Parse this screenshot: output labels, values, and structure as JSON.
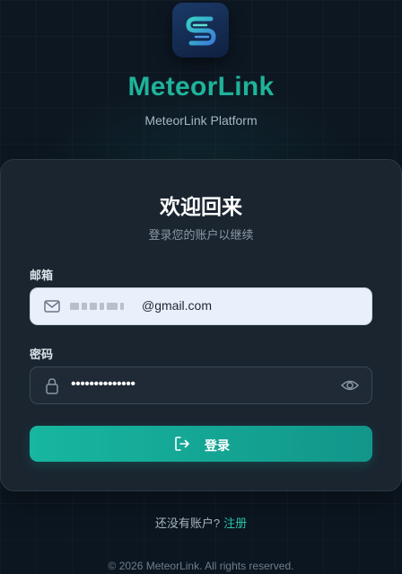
{
  "brand": {
    "name": "MeteorLink",
    "tagline": "MeteorLink Platform",
    "logo_icon": "meteor-s-logo"
  },
  "login": {
    "title": "欢迎回来",
    "subtitle": "登录您的账户以继续",
    "email_label": "邮箱",
    "email_value": "@gmail.com",
    "password_label": "密码",
    "password_value": "••••••••••••••",
    "submit_label": "登录"
  },
  "register": {
    "prompt": "还没有账户?",
    "link": "注册"
  },
  "footer": {
    "copyright": "© 2026 MeteorLink. All rights reserved."
  },
  "colors": {
    "accent": "#1fb39a",
    "background": "#0d1722",
    "card": "#1a2530"
  },
  "icons": {
    "email": "mail-icon",
    "password": "lock-icon",
    "toggle": "eye-icon",
    "submit": "login-icon"
  }
}
